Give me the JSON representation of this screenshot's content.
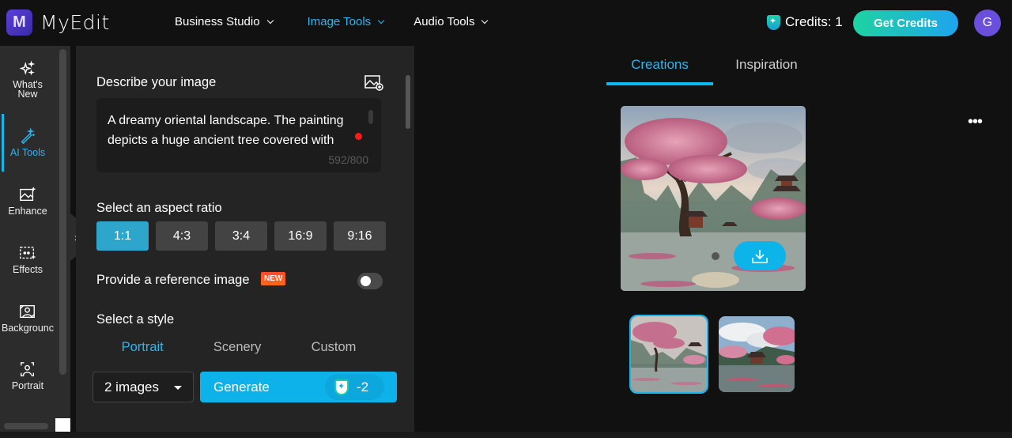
{
  "app": {
    "name": "MyEdit",
    "logo_letter": "M"
  },
  "nav": [
    {
      "label": "Business Studio",
      "active": false
    },
    {
      "label": "Image Tools",
      "active": true
    },
    {
      "label": "Audio Tools",
      "active": false
    }
  ],
  "header": {
    "credits_label": "Credits: 1",
    "get_credits_label": "Get Credits",
    "avatar_initial": "G"
  },
  "sidebar": {
    "items": [
      {
        "label": "What's New",
        "icon": "sparkles-icon",
        "active": false
      },
      {
        "label": "AI Tools",
        "icon": "magic-wand-icon",
        "active": true
      },
      {
        "label": "Enhance",
        "icon": "image-enhance-icon",
        "active": false
      },
      {
        "label": "Effects",
        "icon": "effects-icon",
        "active": false
      },
      {
        "label": "Backgrounc",
        "icon": "background-icon",
        "active": false
      },
      {
        "label": "Portrait",
        "icon": "portrait-icon",
        "active": false
      }
    ]
  },
  "panel": {
    "describe_label": "Describe your image",
    "prompt_value": "A dreamy oriental landscape. The painting depicts a huge ancient tree covered with",
    "char_count": "592/800",
    "aspect_label": "Select an aspect ratio",
    "aspect_ratios": [
      "1:1",
      "4:3",
      "3:4",
      "16:9",
      "9:16"
    ],
    "aspect_selected": "1:1",
    "reference_label": "Provide a reference image",
    "new_badge": "NEW",
    "reference_enabled": false,
    "style_label": "Select a style",
    "style_tabs": [
      "Portrait",
      "Scenery",
      "Custom"
    ],
    "style_selected": "Portrait",
    "count_value": "2 images",
    "generate_label": "Generate",
    "generate_cost": "-2"
  },
  "results": {
    "tabs": [
      "Creations",
      "Inspiration"
    ],
    "active_tab": "Creations",
    "more_label": "•••",
    "thumbnails": 2,
    "selected_thumbnail": 1
  },
  "colors": {
    "accent": "#0db4ea",
    "active_text": "#2fb4ee",
    "new_badge": "#ff4a2a",
    "avatar": "#6a4fdc"
  }
}
